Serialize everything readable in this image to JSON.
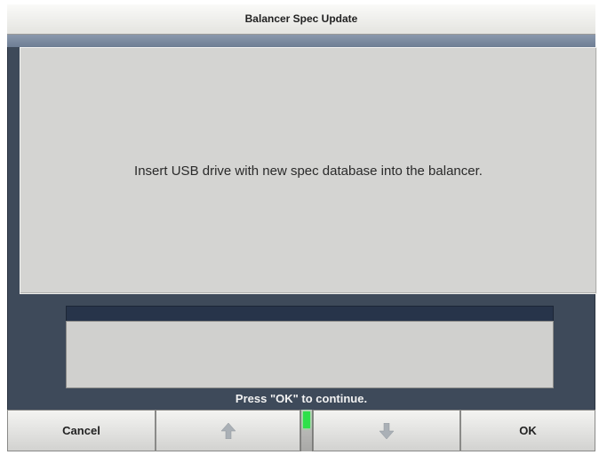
{
  "window": {
    "title": "Balancer Spec Update"
  },
  "message": {
    "text": "Insert USB drive with new spec database into the balancer."
  },
  "status": {
    "prompt": "Press \"OK\" to continue.",
    "indicator_color": "#2ee04a"
  },
  "softkeys": {
    "cancel_label": "Cancel",
    "up_icon": "arrow-up-icon",
    "down_icon": "arrow-down-icon",
    "ok_label": "OK"
  },
  "colors": {
    "background": "#3e4a5a",
    "panel": "#d4d4d2",
    "info_header": "#27344a"
  }
}
